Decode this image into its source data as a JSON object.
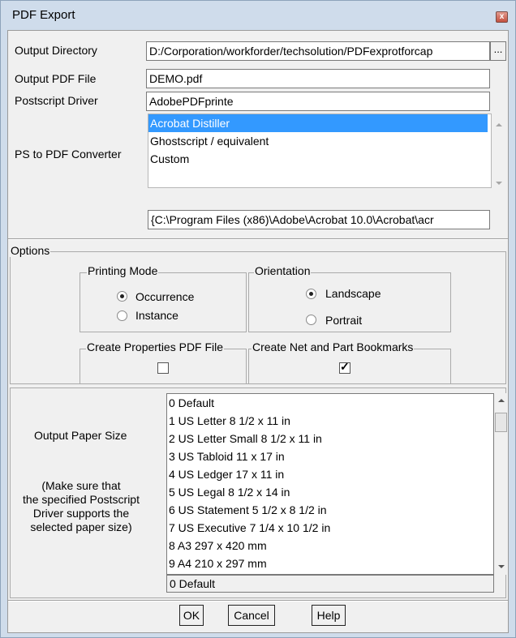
{
  "window": {
    "title": "PDF Export",
    "close_glyph": "x"
  },
  "fields": {
    "output_directory": {
      "label": "Output Directory",
      "value": "D:/Corporation/workforder/techsolution/PDFexprotforcap",
      "browse_label": "..."
    },
    "output_pdf_file": {
      "label": "Output PDF File",
      "value": "DEMO.pdf"
    },
    "postscript_driver": {
      "label": "Postscript Driver",
      "value": "AdobePDFprinte"
    },
    "converter": {
      "label": "PS to PDF Converter",
      "items": [
        "Acrobat Distiller",
        "Ghostscript / equivalent",
        "Custom"
      ],
      "selected_index": 0,
      "path": "{C:\\Program Files (x86)\\Adobe\\Acrobat 10.0\\Acrobat\\acr"
    }
  },
  "options": {
    "label": "Options",
    "printing_mode": {
      "label": "Printing Mode",
      "choices": [
        "Occurrence",
        "Instance"
      ],
      "selected": "Occurrence"
    },
    "orientation": {
      "label": "Orientation",
      "choices": [
        "Landscape",
        "Portrait"
      ],
      "selected": "Landscape"
    },
    "create_properties_pdf": {
      "label": "Create Properties PDF File",
      "checked": false
    },
    "create_bookmarks": {
      "label": "Create Net and Part Bookmarks",
      "checked": true
    }
  },
  "paper": {
    "label": "Output Paper Size",
    "note": [
      "(Make sure that",
      "the specified Postscript",
      "Driver supports the",
      "selected paper size)"
    ],
    "items": [
      "0 Default",
      "1 US Letter 8 1/2 x 11 in",
      "2 US Letter Small 8 1/2 x 11 in",
      "3 US Tabloid 11 x 17 in",
      "4 US Ledger 17 x 11 in",
      "5 US Legal 8 1/2 x 14 in",
      "6 US Statement 5 1/2 x 8 1/2 in",
      "7 US Executive 7 1/4 x 10 1/2 in",
      "8 A3 297 x 420 mm",
      "9 A4 210 x 297 mm"
    ],
    "selected_value": "0 Default"
  },
  "buttons": {
    "ok": "OK",
    "cancel": "Cancel",
    "help": "Help"
  }
}
